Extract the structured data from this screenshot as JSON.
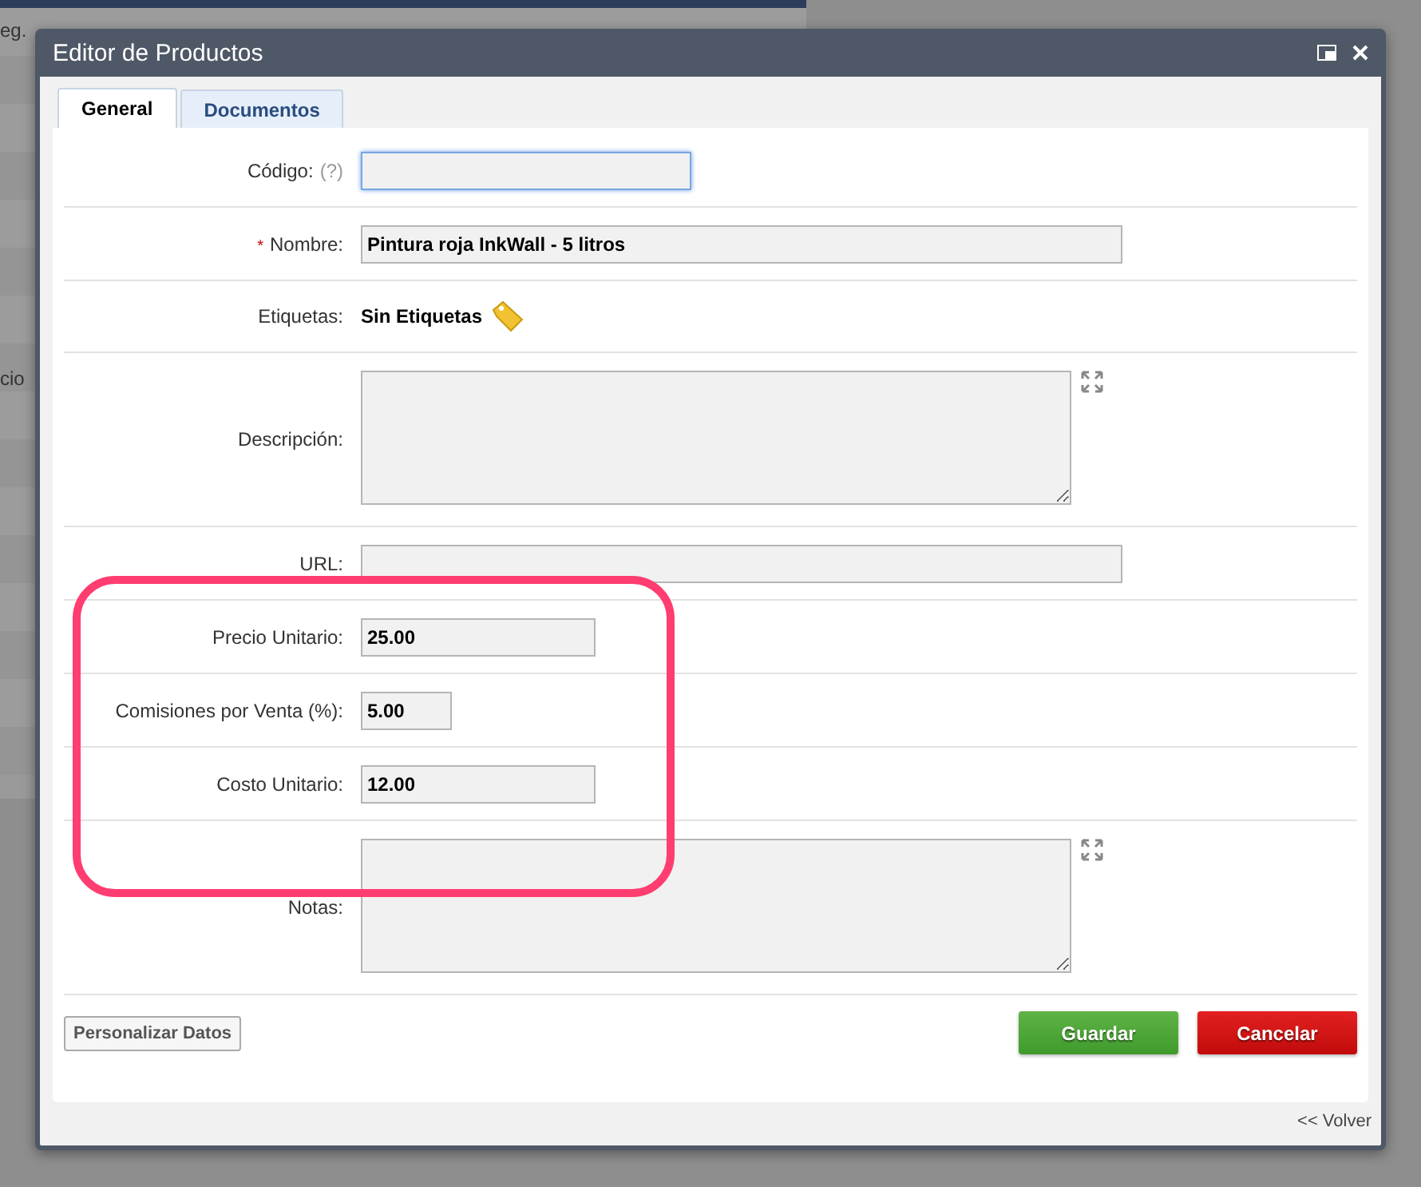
{
  "background": {
    "texts": [
      "eg.",
      "cio"
    ]
  },
  "window": {
    "title": "Editor de Productos"
  },
  "tabs": [
    {
      "label": "General",
      "selected": true
    },
    {
      "label": "Documentos",
      "selected": false
    }
  ],
  "fields": [
    {
      "kind": "text",
      "label": "Código:",
      "help": "(?)",
      "focused": true
    },
    {
      "kind": "text",
      "label": "Nombre:",
      "marker": "*",
      "value": "Pintura roja InkWall - 5 litros",
      "focused": false
    },
    {
      "kind": "tags",
      "label": "Etiquetas:",
      "value": "Sin Etiquetas"
    },
    {
      "kind": "textarea",
      "label": "Descripción:"
    },
    {
      "kind": "text",
      "label": "URL:",
      "focused": false
    },
    {
      "kind": "text",
      "label": "Precio Unitario:",
      "value": "25.00",
      "focused": false
    },
    {
      "kind": "text",
      "label": "Comisiones por Venta (%):",
      "value": "5.00",
      "focused": false
    },
    {
      "kind": "text",
      "label": "Costo Unitario:",
      "value": "12.00",
      "focused": false
    },
    {
      "kind": "textarea",
      "label": "Notas:"
    }
  ],
  "buttons": {
    "customize": "Personalizar Datos",
    "save": "Guardar",
    "cancel": "Cancelar"
  },
  "back_link": "<< Volver"
}
